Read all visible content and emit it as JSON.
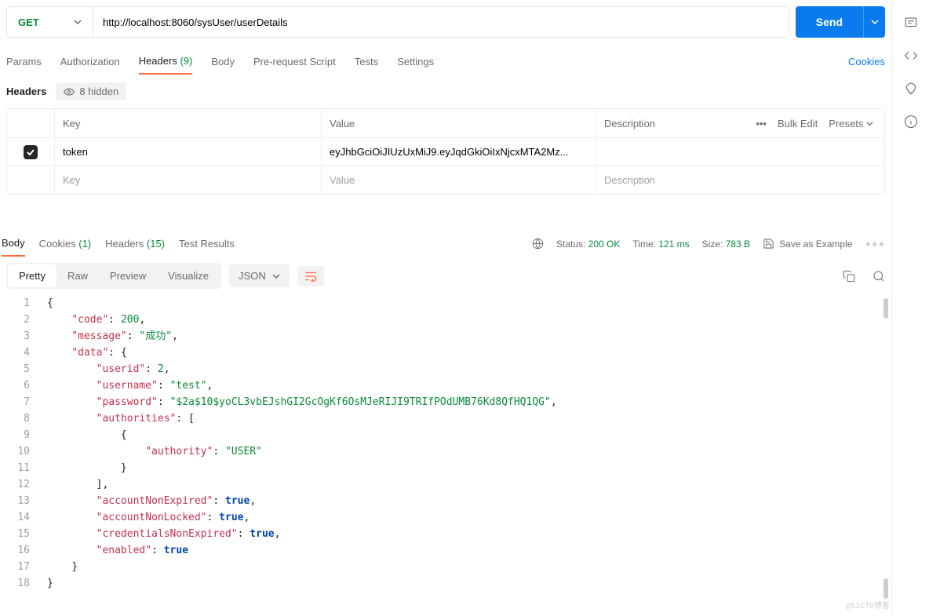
{
  "request": {
    "method": "GET",
    "url": "http://localhost:8060/sysUser/userDetails",
    "send_label": "Send"
  },
  "req_tabs": {
    "params": "Params",
    "auth": "Authorization",
    "headers": "Headers",
    "headers_count": "(9)",
    "body": "Body",
    "prereq": "Pre-request Script",
    "tests": "Tests",
    "settings": "Settings",
    "cookies": "Cookies"
  },
  "headers_section": {
    "title": "Headers",
    "hidden": "8 hidden",
    "cols": {
      "key": "Key",
      "value": "Value",
      "description": "Description",
      "bulk": "Bulk Edit",
      "presets": "Presets"
    },
    "row": {
      "key": "token",
      "value": "eyJhbGciOiJIUzUxMiJ9.eyJqdGkiOiIxNjcxMTA2Mz..."
    },
    "placeholder": {
      "key": "Key",
      "value": "Value",
      "description": "Description"
    }
  },
  "resp_tabs": {
    "body": "Body",
    "cookies": "Cookies",
    "cookies_count": "(1)",
    "headers": "Headers",
    "headers_count": "(15)",
    "tests": "Test Results"
  },
  "status": {
    "status_label": "Status:",
    "status_value": "200 OK",
    "time_label": "Time:",
    "time_value": "121 ms",
    "size_label": "Size:",
    "size_value": "783 B",
    "save": "Save as Example"
  },
  "viewbar": {
    "pretty": "Pretty",
    "raw": "Raw",
    "preview": "Preview",
    "visualize": "Visualize",
    "json": "JSON"
  },
  "json_body": {
    "code": 200,
    "message": "成功",
    "data": {
      "userid": 2,
      "username": "test",
      "password": "$2a$10$yoCL3vbEJshGI2GcOgKf6OsMJeRIJI9TRIfPOdUMB76Kd8QfHQ1QG",
      "authorities": [
        {
          "authority": "USER"
        }
      ],
      "accountNonExpired": true,
      "accountNonLocked": true,
      "credentialsNonExpired": true,
      "enabled": true
    }
  },
  "watermark": "@51CTO博客"
}
